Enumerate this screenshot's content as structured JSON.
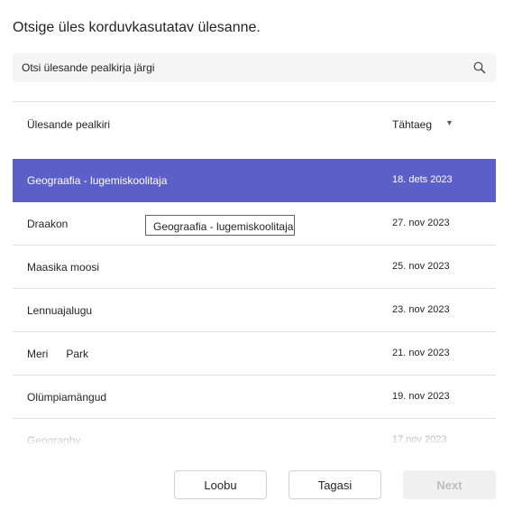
{
  "dialog": {
    "title": "Otsige üles korduvkasutatav ülesanne."
  },
  "search": {
    "placeholder": "Otsi ülesande pealkirja järgi",
    "icon": "search-icon"
  },
  "table": {
    "columns": {
      "title": "Ülesande pealkiri",
      "due": "Tähtaeg",
      "sort_icon": "sort-down-icon"
    },
    "rows": [
      {
        "name": "Geograafia - lugemiskoolitaja",
        "date": "18. dets 2023"
      },
      {
        "name": "Draakon",
        "date": "27. nov 2023"
      },
      {
        "name": "Maasika moosi",
        "date": "25. nov 2023"
      },
      {
        "name": "Lennuajalugu",
        "date": "23. nov 2023"
      },
      {
        "name": "Meri      Park",
        "date": "21. nov 2023"
      },
      {
        "name": "Olümpiamängud",
        "date": "19. nov 2023"
      },
      {
        "name": "Geography",
        "date": "17.nov 2023"
      }
    ],
    "selected_index": 0
  },
  "tooltip": {
    "text": "Geograafia - lugemiskoolitaja"
  },
  "footer": {
    "cancel": "Loobu",
    "back": "Tagasi",
    "next": "Next"
  },
  "colors": {
    "accent": "#5b5fc7",
    "divider": "#e0e0e0"
  }
}
